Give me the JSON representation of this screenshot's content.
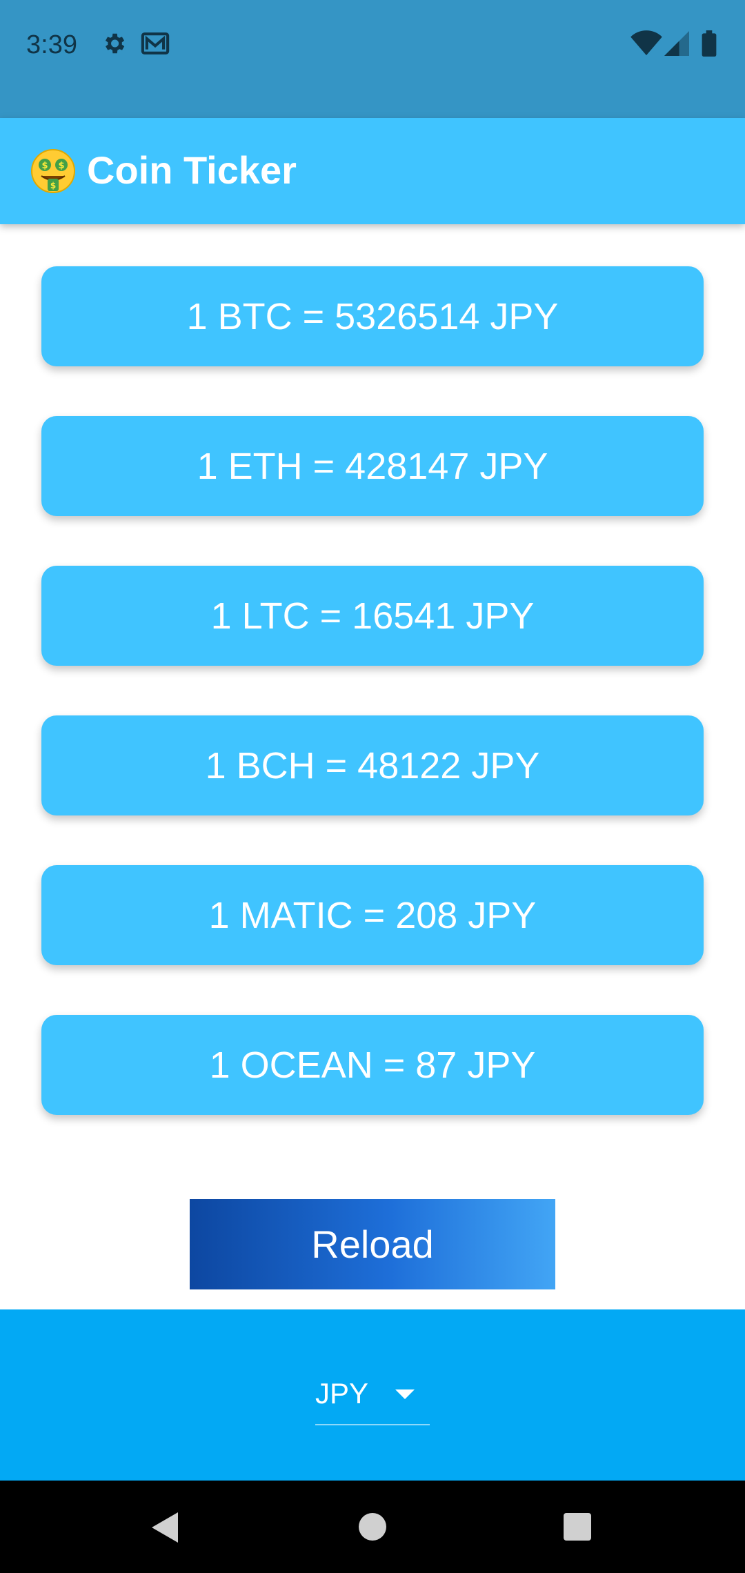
{
  "status_bar": {
    "time": "3:39",
    "left_icons": [
      "gear-icon",
      "mail-icon"
    ],
    "right_icons": [
      "wifi-icon",
      "signal-icon",
      "battery-icon"
    ]
  },
  "app_bar": {
    "emoji_icon": "money-mouth-face-icon",
    "title": "Coin Ticker"
  },
  "rates": [
    {
      "text": "1 BTC = 5326514 JPY"
    },
    {
      "text": "1 ETH = 428147 JPY"
    },
    {
      "text": "1 LTC = 16541 JPY"
    },
    {
      "text": "1 BCH = 48122 JPY"
    },
    {
      "text": "1 MATIC = 208 JPY"
    },
    {
      "text": "1 OCEAN = 87 JPY"
    }
  ],
  "reload": {
    "label": "Reload"
  },
  "currency_picker": {
    "selected": "JPY"
  },
  "colors": {
    "status_bar": "#3595C5",
    "app_bar": "#40C4FF",
    "card": "#40C4FF",
    "bottom_panel": "#03A9F4",
    "reload_gradient_start": "#0D47A1",
    "reload_gradient_end": "#42A5F5"
  }
}
